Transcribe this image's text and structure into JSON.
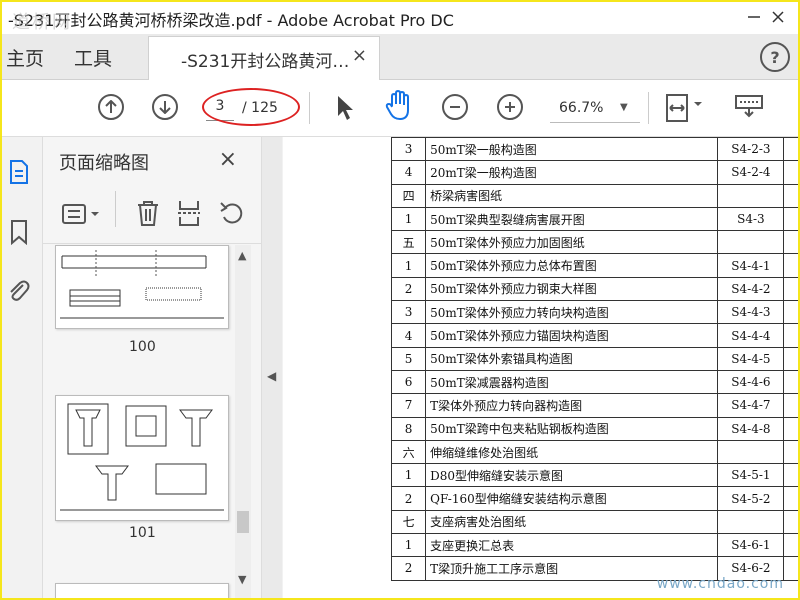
{
  "window": {
    "title": "-S231开封公路黄河桥桥梁改造.pdf - Adobe Acrobat Pro DC",
    "watermark": "道桥网"
  },
  "menu": {
    "home": "主页",
    "tools": "工具"
  },
  "tab": {
    "label": "-S231开封公路黄河…",
    "close": "×"
  },
  "help_label": "?",
  "toolbar": {
    "page_current": "3",
    "page_total": "/ 125",
    "zoom": "66.7%"
  },
  "thumbnails": {
    "title": "页面缩略图",
    "close": "×",
    "pages": [
      "100",
      "101"
    ]
  },
  "table_rows": [
    {
      "no": "3",
      "name": "50mT梁一般构造图",
      "code": "S4-2-3"
    },
    {
      "no": "4",
      "name": "20mT梁一般构造图",
      "code": "S4-2-4"
    },
    {
      "no": "四",
      "name": "桥梁病害图纸",
      "code": ""
    },
    {
      "no": "1",
      "name": "50mT梁典型裂缝病害展开图",
      "code": "S4-3"
    },
    {
      "no": "五",
      "name": "50mT梁体外预应力加固图纸",
      "code": ""
    },
    {
      "no": "1",
      "name": "50mT梁体外预应力总体布置图",
      "code": "S4-4-1"
    },
    {
      "no": "2",
      "name": "50mT梁体外预应力钢束大样图",
      "code": "S4-4-2"
    },
    {
      "no": "3",
      "name": "50mT梁体外预应力转向块构造图",
      "code": "S4-4-3"
    },
    {
      "no": "4",
      "name": "50mT梁体外预应力锚固块构造图",
      "code": "S4-4-4"
    },
    {
      "no": "5",
      "name": "50mT梁体外索锚具构造图",
      "code": "S4-4-5"
    },
    {
      "no": "6",
      "name": "50mT梁减震器构造图",
      "code": "S4-4-6"
    },
    {
      "no": "7",
      "name": "T梁体外预应力转向器构造图",
      "code": "S4-4-7"
    },
    {
      "no": "8",
      "name": "50mT梁跨中包夹粘贴钢板构造图",
      "code": "S4-4-8"
    },
    {
      "no": "六",
      "name": "伸缩缝维修处治图纸",
      "code": ""
    },
    {
      "no": "1",
      "name": "D80型伸缩缝安装示意图",
      "code": "S4-5-1"
    },
    {
      "no": "2",
      "name": "QF-160型伸缩缝安装结构示意图",
      "code": "S4-5-2"
    },
    {
      "no": "七",
      "name": "支座病害处治图纸",
      "code": ""
    },
    {
      "no": "1",
      "name": "支座更换汇总表",
      "code": "S4-6-1"
    },
    {
      "no": "2",
      "name": "T梁顶升施工工序示意图",
      "code": "S4-6-2"
    }
  ],
  "footer_watermark": "www.cndao.com",
  "colors": {
    "highlight_oval": "#dd2222",
    "frame": "#f5e61c",
    "accent": "#1473e6"
  }
}
